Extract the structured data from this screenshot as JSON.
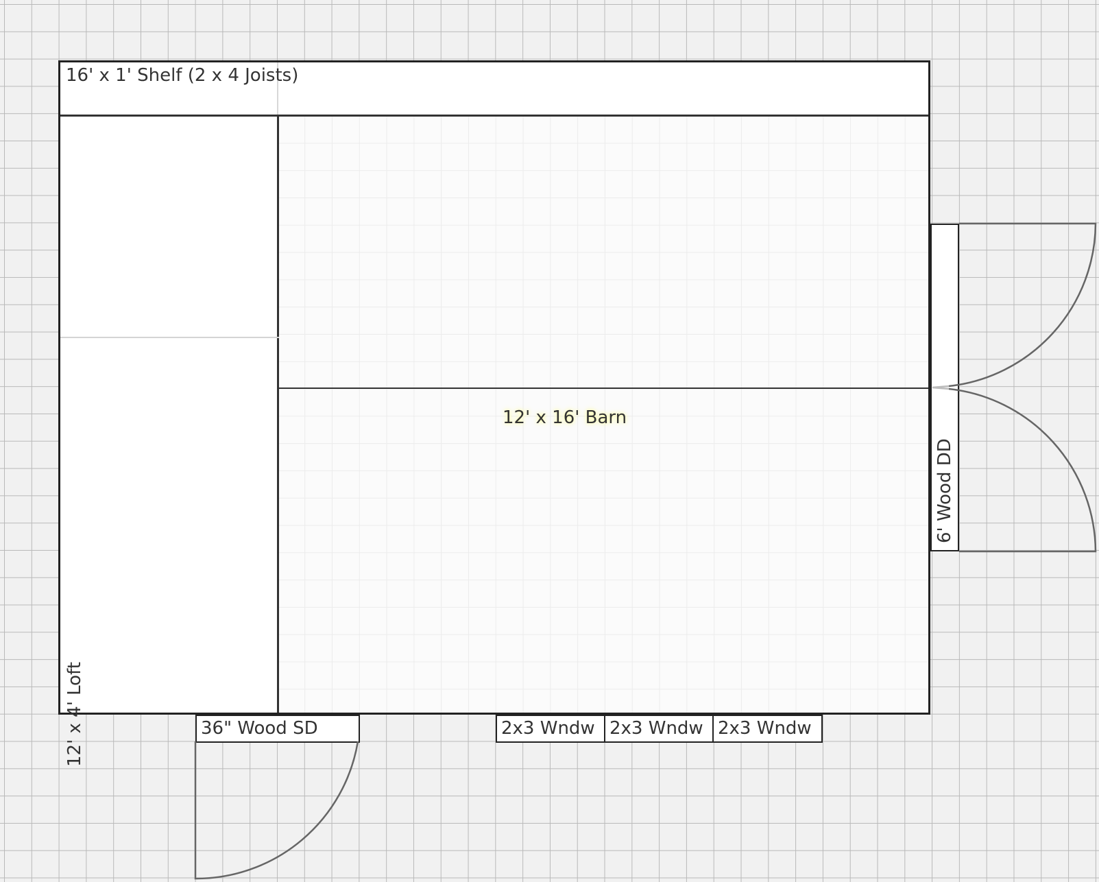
{
  "plan": {
    "shelf_label": "16' x 1' Shelf (2 x 4 Joists)",
    "barn_label": "12' x 16' Barn",
    "loft_label": "12' x 4' Loft",
    "side_door_label": "36\" Wood SD",
    "double_door_label": "6' Wood DD",
    "windows": [
      "2x3 Wndw",
      "2x3 Wndw",
      "2x3 Wndw"
    ]
  },
  "colors": {
    "background": "#f1f1f1",
    "grid": "#b9b9b9",
    "walls": "#222222",
    "door_swing": "#666666",
    "barn_label_glow": "#ffff9a"
  }
}
